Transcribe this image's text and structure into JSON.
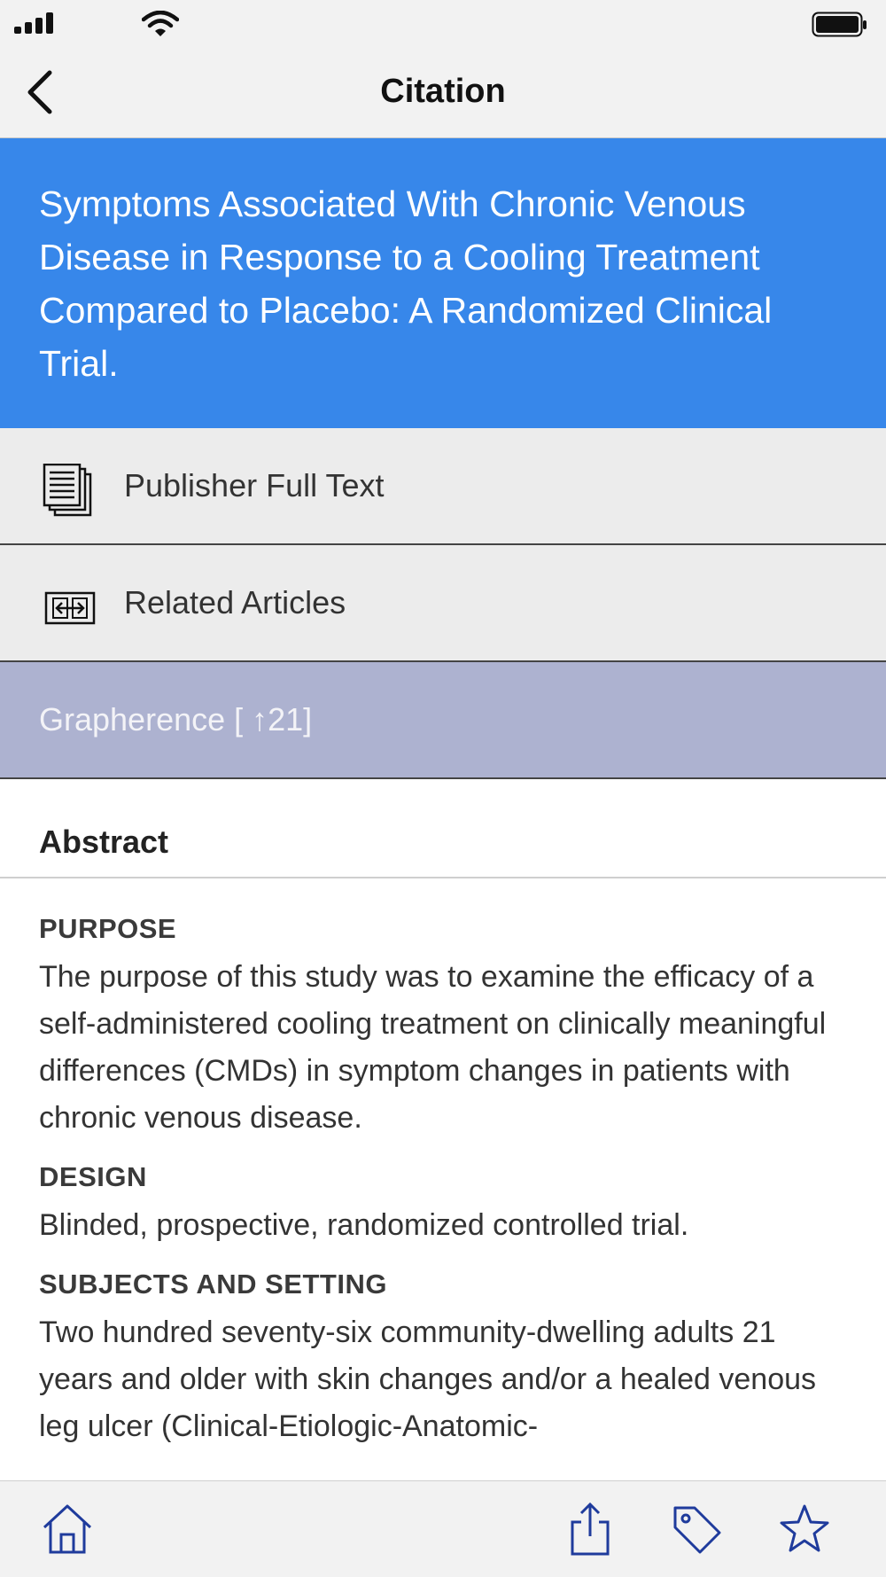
{
  "nav": {
    "title": "Citation"
  },
  "article": {
    "title": "Symptoms Associated With Chronic Venous Disease in Response to a Cooling Treatment Compared to Placebo: A Randomized Clinical Trial."
  },
  "actions": {
    "publisher_full_text": "Publisher Full Text",
    "related_articles": "Related Articles",
    "grapherence": "Grapherence [ ↑21]"
  },
  "abstract": {
    "heading": "Abstract",
    "sections": [
      {
        "heading": "PURPOSE",
        "text": "The purpose of this study was to examine the efficacy of a self-administered cooling treatment on clinically meaningful differences (CMDs) in symptom changes in patients with chronic venous disease."
      },
      {
        "heading": "DESIGN",
        "text": "Blinded, prospective, randomized controlled trial."
      },
      {
        "heading": "SUBJECTS AND SETTING",
        "text": "Two hundred seventy-six community-dwelling adults 21 years and older with skin changes and/or a healed venous leg ulcer (Clinical-Etiologic-Anatomic-"
      }
    ]
  },
  "icons": {
    "back": "chevron-left-icon",
    "publisher": "document-stack-icon",
    "related": "related-articles-icon",
    "home": "home-icon",
    "share": "share-icon",
    "tag": "tag-icon",
    "star": "star-icon"
  },
  "colors": {
    "banner": "#3787ea",
    "grapherence_row": "#adb2d0",
    "tab_icon": "#1f3b9c"
  }
}
